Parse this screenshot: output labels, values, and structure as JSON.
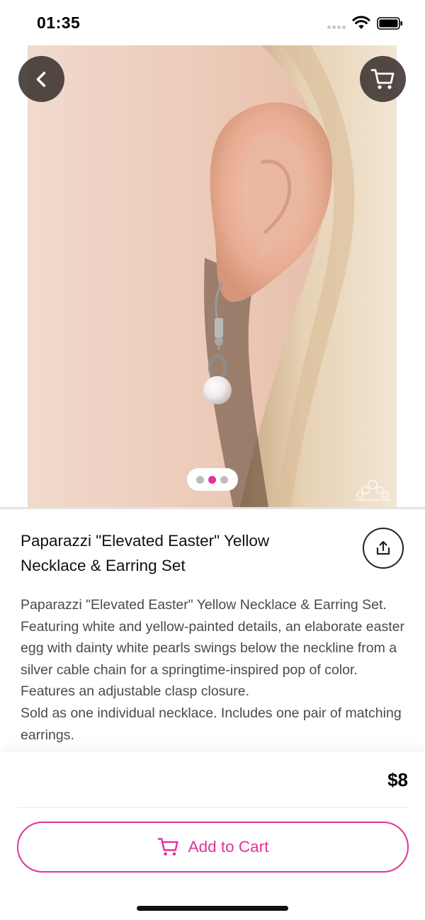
{
  "status_bar": {
    "time": "01:35"
  },
  "product": {
    "title_line1": "Paparazzi \"Elevated Easter\" Yellow",
    "title_line2": "Necklace & Earring Set",
    "description": "Paparazzi \"Elevated Easter\" Yellow Necklace & Earring Set. Featuring white and yellow-painted details, an elaborate easter egg with dainty white pearls swings below the neckline from a silver cable chain for a springtime-inspired pop of color. Features an adjustable clasp closure.\nSold as one individual necklace. Includes one pair of matching earrings.",
    "price": "$8"
  },
  "gallery": {
    "total_images": 3,
    "active_index": 1
  },
  "actions": {
    "add_to_cart_label": "Add to Cart"
  },
  "colors": {
    "accent": "#e0339b",
    "overlay_button": "#3a322f",
    "text": "#111111",
    "muted_text": "#4a4a4a"
  },
  "icons": {
    "back": "chevron-left-icon",
    "cart": "cart-icon",
    "share": "share-upload-icon",
    "wifi": "wifi-icon",
    "battery": "battery-icon"
  }
}
